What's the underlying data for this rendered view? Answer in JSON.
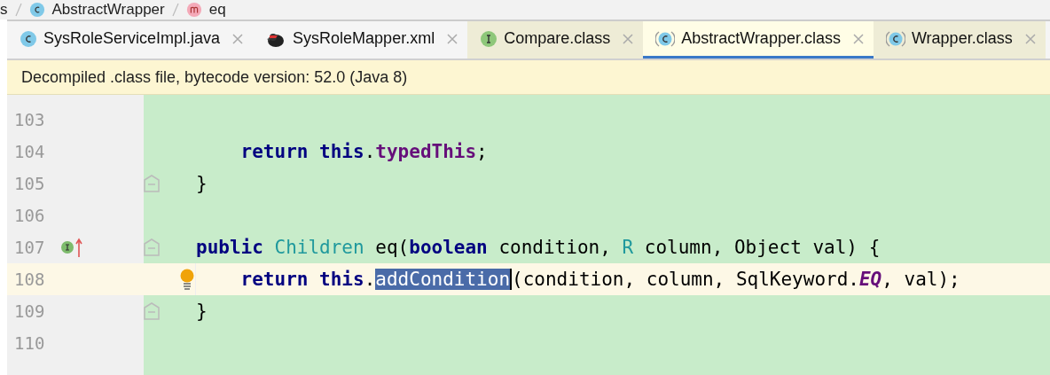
{
  "breadcrumb": [
    {
      "label": "s",
      "kind": "plain"
    },
    {
      "label": "AbstractWrapper",
      "kind": "class"
    },
    {
      "label": "eq",
      "kind": "method"
    }
  ],
  "tabs": [
    {
      "label": "SysRoleServiceImpl.java",
      "kind": "class",
      "library": false,
      "selected": false
    },
    {
      "label": "SysRoleMapper.xml",
      "kind": "xml",
      "library": false,
      "selected": false
    },
    {
      "label": "Compare.class",
      "kind": "interface",
      "library": true,
      "selected": false
    },
    {
      "label": "AbstractWrapper.class",
      "kind": "library-class",
      "library": true,
      "selected": true
    },
    {
      "label": "Wrapper.class",
      "kind": "library-class",
      "library": true,
      "selected": false
    }
  ],
  "notice": "Decompiled .class file, bytecode version: 52.0 (Java 8)",
  "lines": [
    {
      "number": "103",
      "current": false,
      "fold": false,
      "kind": "plain"
    },
    {
      "number": "104",
      "current": false,
      "fold": false,
      "kind": "plain",
      "tokens": [
        {
          "text": "    return",
          "kind": "keyword"
        },
        {
          "text": " this",
          "kind": "keyword"
        },
        {
          "text": ".",
          "kind": "plain"
        },
        {
          "text": "typedThis",
          "kind": "field"
        },
        {
          "text": ";",
          "kind": "plain"
        }
      ]
    },
    {
      "number": "105",
      "current": false,
      "fold": true,
      "kind": "plain",
      "tokens": [
        {
          "text": "}",
          "kind": "plain"
        }
      ]
    },
    {
      "number": "106",
      "current": false,
      "fold": false,
      "kind": "plain"
    },
    {
      "number": "107",
      "current": false,
      "fold": true,
      "kind": "implements",
      "tokens": [
        {
          "text": "public",
          "kind": "keyword"
        },
        {
          "text": " Children",
          "kind": "type"
        },
        {
          "text": " eq(",
          "kind": "plain"
        },
        {
          "text": "boolean",
          "kind": "keyword"
        },
        {
          "text": " condition, ",
          "kind": "plain"
        },
        {
          "text": "R",
          "kind": "type"
        },
        {
          "text": " column, Object val) {",
          "kind": "plain"
        }
      ]
    },
    {
      "number": "108",
      "current": true,
      "fold": false,
      "kind": "bulb",
      "tokens": [
        {
          "text": "    return",
          "kind": "keyword"
        },
        {
          "text": " this",
          "kind": "keyword"
        },
        {
          "text": ".",
          "kind": "plain"
        },
        {
          "text": "addCondition",
          "kind": "selection"
        },
        {
          "text": "(condition, column, SqlKeyword.",
          "kind": "plain"
        },
        {
          "text": "EQ",
          "kind": "constant"
        },
        {
          "text": ", val);",
          "kind": "plain"
        }
      ]
    },
    {
      "number": "109",
      "current": false,
      "fold": true,
      "kind": "plain",
      "tokens": [
        {
          "text": "}",
          "kind": "plain"
        }
      ]
    },
    {
      "number": "110",
      "current": false,
      "fold": false,
      "kind": "plain"
    }
  ]
}
